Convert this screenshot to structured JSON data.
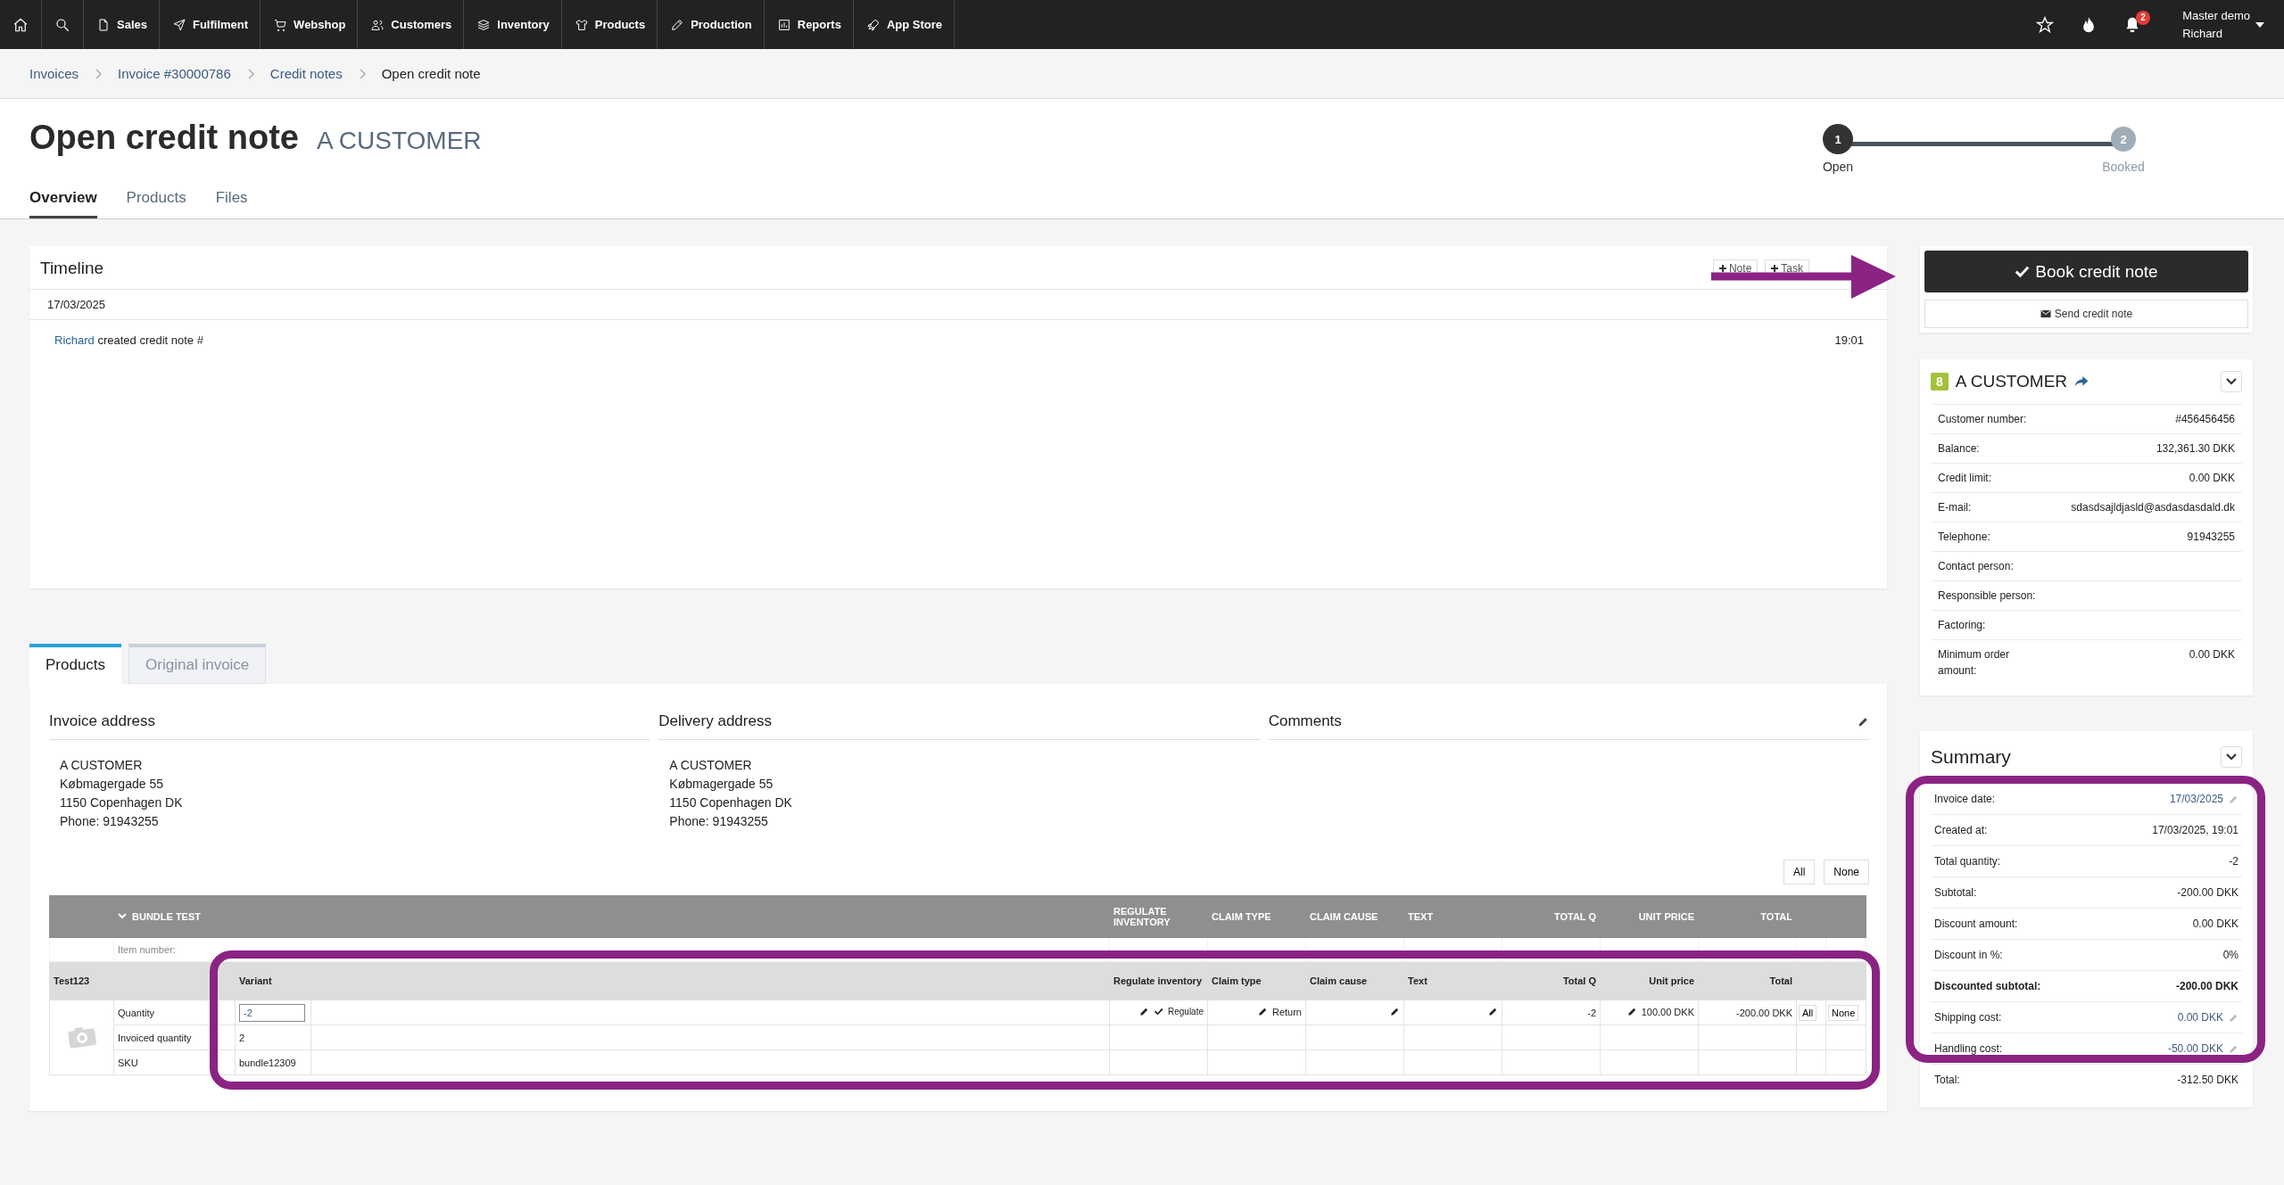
{
  "nav": {
    "items": [
      {
        "label": "Sales"
      },
      {
        "label": "Fulfilment"
      },
      {
        "label": "Webshop"
      },
      {
        "label": "Customers"
      },
      {
        "label": "Inventory"
      },
      {
        "label": "Products"
      },
      {
        "label": "Production"
      },
      {
        "label": "Reports"
      },
      {
        "label": "App Store"
      }
    ],
    "notification_count": "2",
    "user": {
      "account": "Master demo",
      "name": "Richard"
    }
  },
  "breadcrumbs": [
    {
      "label": "Invoices",
      "current": false
    },
    {
      "label": "Invoice #30000786",
      "current": false
    },
    {
      "label": "Credit notes",
      "current": false
    },
    {
      "label": "Open credit note",
      "current": true
    }
  ],
  "header": {
    "title": "Open credit note",
    "customer": "A CUSTOMER"
  },
  "steps": [
    {
      "number": "1",
      "label": "Open",
      "active": true
    },
    {
      "number": "2",
      "label": "Booked",
      "active": false
    }
  ],
  "tabs": [
    {
      "label": "Overview",
      "selected": true
    },
    {
      "label": "Products",
      "selected": false
    },
    {
      "label": "Files",
      "selected": false
    }
  ],
  "timeline": {
    "title": "Timeline",
    "buttons": [
      "Note",
      "Task"
    ],
    "date": "17/03/2025",
    "entries": [
      {
        "user": "Richard",
        "text": "created credit note #",
        "time": "19:01"
      }
    ]
  },
  "actions": {
    "primary": "Book credit note",
    "secondary": "Send credit note"
  },
  "customer": {
    "badge": "8",
    "name": "A CUSTOMER",
    "fields": [
      {
        "label": "Customer number:",
        "value": "#456456456"
      },
      {
        "label": "Balance:",
        "value": "132,361.30 DKK"
      },
      {
        "label": "Credit limit:",
        "value": "0.00 DKK"
      },
      {
        "label": "E-mail:",
        "value": "sdasdsajldjasld@asdasdasdald.dk"
      },
      {
        "label": "Telephone:",
        "value": "91943255"
      },
      {
        "label": "Contact person:"
      },
      {
        "label": "Responsible person:"
      },
      {
        "label": "Factoring:"
      },
      {
        "label": "Minimum order amount:",
        "value": "0.00 DKK"
      }
    ]
  },
  "summary": {
    "title": "Summary",
    "rows": [
      {
        "label": "Invoice date:",
        "value": "17/03/2025",
        "bold": false,
        "editable": true
      },
      {
        "label": "Created at:",
        "value": "17/03/2025, 19:01",
        "bold": false,
        "editable": false
      },
      {
        "label": "Total quantity:",
        "value": "-2",
        "bold": false,
        "editable": false
      },
      {
        "label": "Subtotal:",
        "value": "-200.00 DKK",
        "bold": false,
        "editable": false
      },
      {
        "label": "Discount amount:",
        "value": "0.00 DKK",
        "bold": false,
        "editable": false
      },
      {
        "label": "Discount in %:",
        "value": "0%",
        "bold": false,
        "editable": false
      },
      {
        "label": "Discounted subtotal:",
        "value": "-200.00 DKK",
        "bold": true,
        "editable": false
      },
      {
        "label": "Shipping cost:",
        "value": "0.00 DKK",
        "bold": false,
        "editable": true
      },
      {
        "label": "Handling cost:",
        "value": "-50.00 DKK",
        "bold": false,
        "editable": true
      },
      {
        "label": "Total:",
        "value": "-312.50 DKK",
        "bold": false,
        "editable": false
      }
    ]
  },
  "product_tabs": [
    {
      "label": "Products",
      "selected": true
    },
    {
      "label": "Original invoice",
      "selected": false
    }
  ],
  "addresses": [
    {
      "title": "Invoice address",
      "editable": false,
      "lines": [
        "A CUSTOMER",
        "Købmagergade 55",
        "1150 Copenhagen DK",
        "Phone: 91943255"
      ]
    },
    {
      "title": "Delivery address",
      "editable": false,
      "lines": [
        "A CUSTOMER",
        "Købmagergade 55",
        "1150 Copenhagen DK",
        "Phone: 91943255"
      ]
    },
    {
      "title": "Comments",
      "editable": true
    }
  ],
  "table": {
    "buttons": [
      "All",
      "None"
    ],
    "group": "BUNDLE TEST",
    "columns": [
      "REGULATE INVENTORY",
      "CLAIM TYPE",
      "CLAIM CAUSE",
      "TEXT",
      "TOTAL Q",
      "UNIT PRICE",
      "TOTAL"
    ],
    "item_number_label": "Item number:",
    "product": {
      "name": "Test123",
      "variant_heading": "Variant",
      "columns": [
        "Regulate inventory",
        "Claim type",
        "Claim cause",
        "Text",
        "Total Q",
        "Unit price",
        "Total"
      ],
      "rows": [
        {
          "label": "Quantity",
          "kind": "input",
          "value": "-2"
        },
        {
          "label": "Invoiced quantity",
          "kind": "text",
          "value": "2"
        },
        {
          "label": "SKU",
          "kind": "text",
          "value": "bundle12309"
        }
      ],
      "line": {
        "regulate": "Regulate",
        "regulate_checked": true,
        "claim_type": "Return",
        "total_q": "-2",
        "unit_price": "100.00 DKK",
        "total": "-200.00 DKK",
        "buttons": [
          "All",
          "None"
        ]
      }
    }
  }
}
